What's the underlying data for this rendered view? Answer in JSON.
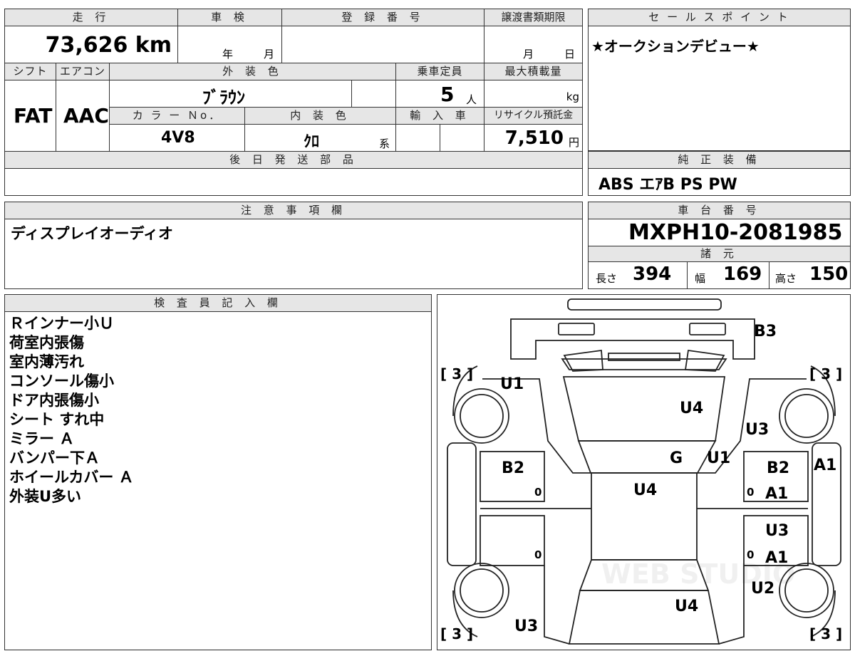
{
  "main": {
    "mileage_label": "走 行",
    "mileage_value": "73,626 km",
    "inspection_label": "車 検",
    "inspection_year": "年",
    "inspection_month": "月",
    "registration_label": "登 録 番 号",
    "transfer_label": "譲渡書類期限",
    "transfer_month": "月",
    "transfer_day": "日",
    "shift_label": "シフト",
    "shift_value": "FAT",
    "ac_label": "エアコン",
    "ac_value": "AAC",
    "exterior_color_label": "外 装 色",
    "exterior_color_value": "ﾌﾞﾗｳﾝ",
    "capacity_label": "乗車定員",
    "capacity_value": "5",
    "capacity_unit": "人",
    "max_load_label": "最大積載量",
    "max_load_unit": "kg",
    "color_no_label": "カ ラ ー Ｎo．",
    "color_no_value": "4V8",
    "interior_color_label": "内 装 色",
    "interior_color_value": "ｸﾛ",
    "interior_color_suffix": "系",
    "import_label": "輸 入 車",
    "recycle_label": "リサイクル預託金",
    "recycle_value": "7,510",
    "recycle_unit": "円",
    "later_parts_label": "後 日 発 送 部 品"
  },
  "sales_point": {
    "label": "セ ー ル ス ポ イ ン ト",
    "value": "★オークションデビュー★"
  },
  "equipment": {
    "label": "純 正 装 備",
    "value": "ABS エｱB PS PW"
  },
  "notes": {
    "label": "注 意 事 項 欄",
    "value": "ディスプレイオーディオ"
  },
  "chassis": {
    "label": "車 台 番 号",
    "value": "MXPH10-2081985",
    "dims_label": "諸 元",
    "length_label": "長さ",
    "length_value": "394",
    "width_label": "幅",
    "width_value": "169",
    "height_label": "高さ",
    "height_value": "150"
  },
  "inspector": {
    "label": "検 査 員 記 入 欄",
    "lines": [
      "Ｒインナー小Ｕ",
      "荷室内張傷",
      "室内薄汚れ",
      "コンソール傷小",
      "ドア内張傷小",
      "シート すれ中",
      "ミラー Ａ",
      "バンパー下Ａ",
      "ホイールカバー Ａ",
      "外装U多い"
    ]
  },
  "diagram": {
    "tire_marks": [
      "[ 3 ]",
      "[ 3 ]",
      "[ 3 ]",
      "[ 3 ]"
    ],
    "zero_marks": [
      "0",
      "0",
      "0",
      "0"
    ],
    "damage_codes": [
      "B3",
      "U1",
      "U4",
      "U3",
      "G",
      "U1",
      "B2",
      "B2",
      "A1",
      "U4",
      "A1",
      "U3",
      "A1",
      "U2",
      "U4",
      "U3"
    ],
    "watermark": "WEB STUDIO"
  }
}
